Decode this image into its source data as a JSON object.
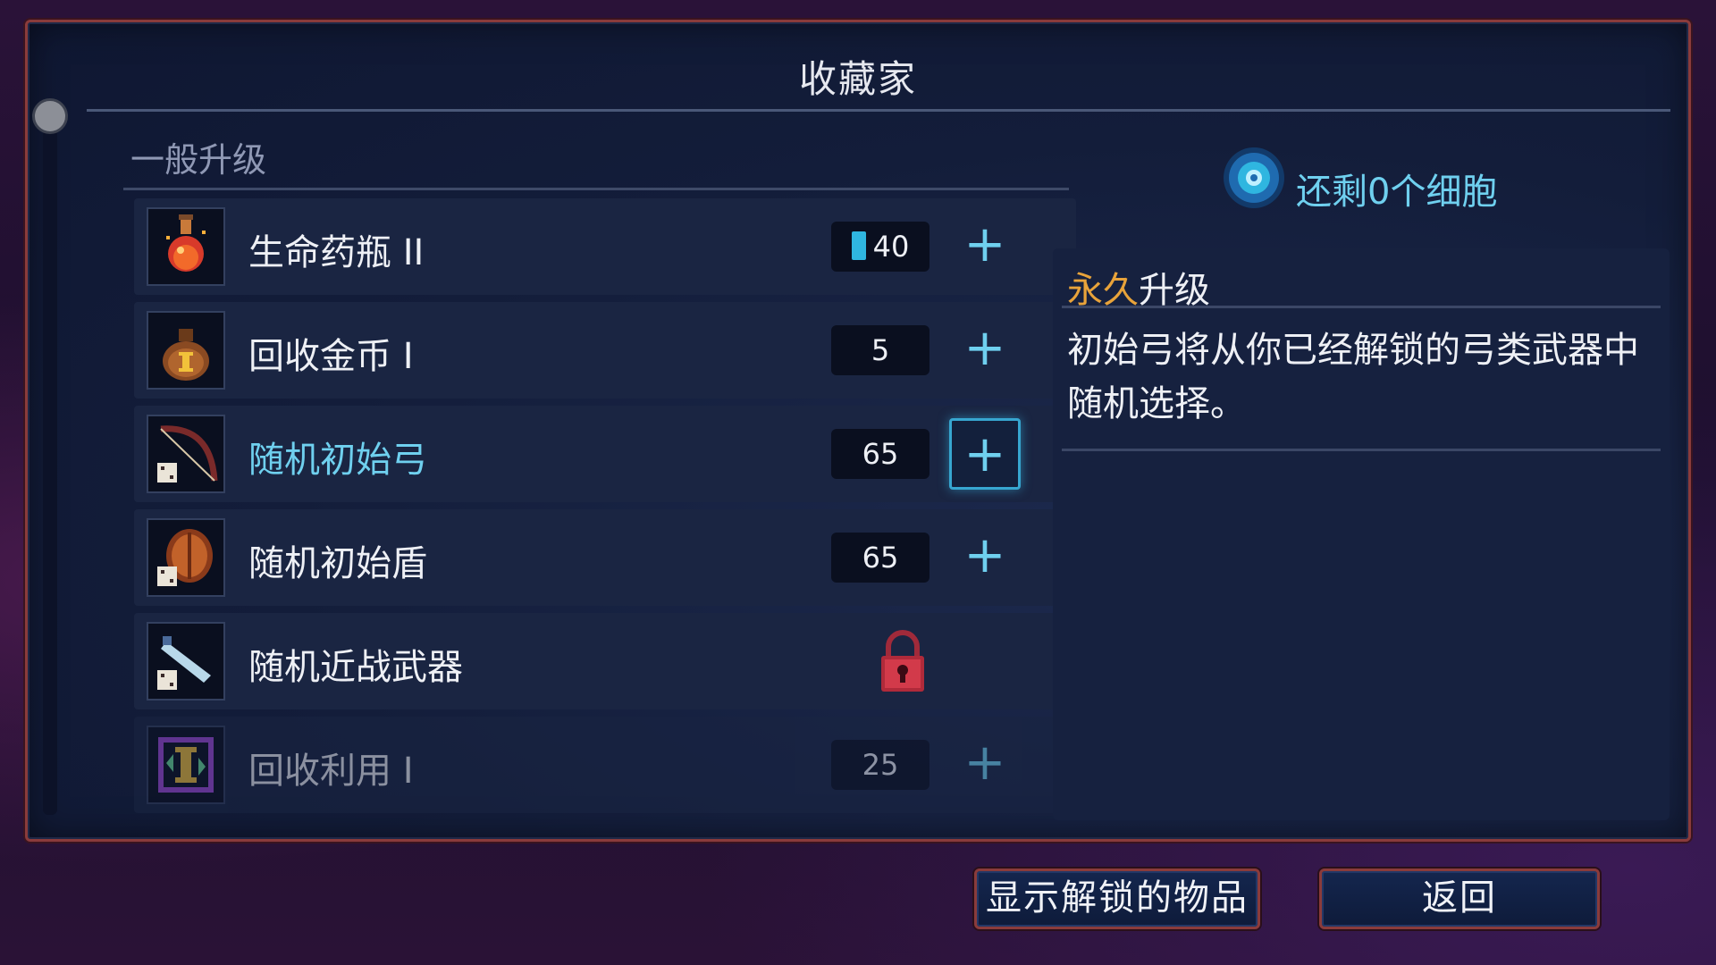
{
  "window": {
    "title": "收藏家"
  },
  "section": {
    "header": "一般升级"
  },
  "items": [
    {
      "label": "生命药瓶 II",
      "cost": "40",
      "icon": "health-flask-icon",
      "action": "+"
    },
    {
      "label": "回收金币 I",
      "cost": "5",
      "icon": "gold-bag-icon",
      "action": "+"
    },
    {
      "label": "随机初始弓",
      "cost": "65",
      "icon": "random-bow-icon",
      "action": "+"
    },
    {
      "label": "随机初始盾",
      "cost": "65",
      "icon": "random-shield-icon",
      "action": "+"
    },
    {
      "label": "随机近战武器",
      "cost": "",
      "icon": "random-melee-icon",
      "locked": true
    },
    {
      "label": "回收利用 I",
      "cost": "25",
      "icon": "recycle-icon",
      "action": "+"
    }
  ],
  "cells": {
    "text": "还剩0个细胞",
    "icon": "cell-icon"
  },
  "detail": {
    "title_accent": "永久",
    "title_rest": "升级",
    "body": "初始弓将从你已经解锁的弓类武器中随机选择。"
  },
  "buttons": {
    "show_unlocked": "显示解锁的物品",
    "back": "返回"
  },
  "colors": {
    "accent_cyan": "#6fd0ef",
    "accent_orange": "#e8a33a",
    "frame_red": "#8a3b3b",
    "cell_blue": "#2fb6e0"
  }
}
